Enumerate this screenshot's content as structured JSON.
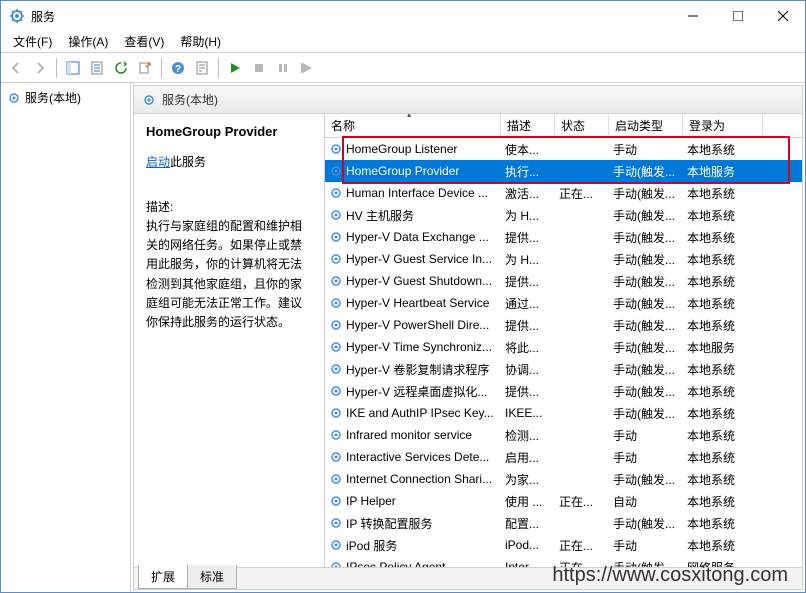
{
  "window": {
    "title": "服务"
  },
  "menus": {
    "file": "文件(F)",
    "action": "操作(A)",
    "view": "查看(V)",
    "help": "帮助(H)"
  },
  "tree": {
    "root": "服务(本地)"
  },
  "pane_header": "服务(本地)",
  "detail": {
    "service_name": "HomeGroup Provider",
    "start_link": "启动",
    "start_suffix": "此服务",
    "desc_label": "描述:",
    "desc_text": "执行与家庭组的配置和维护相关的网络任务。如果停止或禁用此服务，你的计算机将无法检测到其他家庭组，且你的家庭组可能无法正常工作。建议你保持此服务的运行状态。"
  },
  "columns": {
    "name": "名称",
    "desc": "描述",
    "status": "状态",
    "start": "启动类型",
    "logon": "登录为"
  },
  "services": [
    {
      "name": "HomeGroup Listener",
      "desc": "使本...",
      "status": "",
      "start": "手动",
      "logon": "本地系统",
      "selected": false
    },
    {
      "name": "HomeGroup Provider",
      "desc": "执行...",
      "status": "",
      "start": "手动(触发...",
      "logon": "本地服务",
      "selected": true
    },
    {
      "name": "Human Interface Device ...",
      "desc": "激活...",
      "status": "正在...",
      "start": "手动(触发...",
      "logon": "本地系统",
      "selected": false
    },
    {
      "name": "HV 主机服务",
      "desc": "为 H...",
      "status": "",
      "start": "手动(触发...",
      "logon": "本地系统",
      "selected": false
    },
    {
      "name": "Hyper-V Data Exchange ...",
      "desc": "提供...",
      "status": "",
      "start": "手动(触发...",
      "logon": "本地系统",
      "selected": false
    },
    {
      "name": "Hyper-V Guest Service In...",
      "desc": "为 H...",
      "status": "",
      "start": "手动(触发...",
      "logon": "本地系统",
      "selected": false
    },
    {
      "name": "Hyper-V Guest Shutdown...",
      "desc": "提供...",
      "status": "",
      "start": "手动(触发...",
      "logon": "本地系统",
      "selected": false
    },
    {
      "name": "Hyper-V Heartbeat Service",
      "desc": "通过...",
      "status": "",
      "start": "手动(触发...",
      "logon": "本地系统",
      "selected": false
    },
    {
      "name": "Hyper-V PowerShell Dire...",
      "desc": "提供...",
      "status": "",
      "start": "手动(触发...",
      "logon": "本地系统",
      "selected": false
    },
    {
      "name": "Hyper-V Time Synchroniz...",
      "desc": "将此...",
      "status": "",
      "start": "手动(触发...",
      "logon": "本地服务",
      "selected": false
    },
    {
      "name": "Hyper-V 卷影复制请求程序",
      "desc": "协调...",
      "status": "",
      "start": "手动(触发...",
      "logon": "本地系统",
      "selected": false
    },
    {
      "name": "Hyper-V 远程桌面虚拟化...",
      "desc": "提供...",
      "status": "",
      "start": "手动(触发...",
      "logon": "本地系统",
      "selected": false
    },
    {
      "name": "IKE and AuthIP IPsec Key...",
      "desc": "IKEE...",
      "status": "",
      "start": "手动(触发...",
      "logon": "本地系统",
      "selected": false
    },
    {
      "name": "Infrared monitor service",
      "desc": "检测...",
      "status": "",
      "start": "手动",
      "logon": "本地系统",
      "selected": false
    },
    {
      "name": "Interactive Services Dete...",
      "desc": "启用...",
      "status": "",
      "start": "手动",
      "logon": "本地系统",
      "selected": false
    },
    {
      "name": "Internet Connection Shari...",
      "desc": "为家...",
      "status": "",
      "start": "手动(触发...",
      "logon": "本地系统",
      "selected": false
    },
    {
      "name": "IP Helper",
      "desc": "使用 ...",
      "status": "正在...",
      "start": "自动",
      "logon": "本地系统",
      "selected": false
    },
    {
      "name": "IP 转换配置服务",
      "desc": "配置...",
      "status": "",
      "start": "手动(触发...",
      "logon": "本地系统",
      "selected": false
    },
    {
      "name": "iPod 服务",
      "desc": "iPod...",
      "status": "正在...",
      "start": "手动",
      "logon": "本地系统",
      "selected": false
    },
    {
      "name": "IPsec Policy Agent",
      "desc": "Inter...",
      "status": "正在...",
      "start": "手动(触发...",
      "logon": "网络服务",
      "selected": false
    }
  ],
  "tabs": {
    "extended": "扩展",
    "standard": "标准"
  },
  "watermark": "https://www.cosxitong.com"
}
